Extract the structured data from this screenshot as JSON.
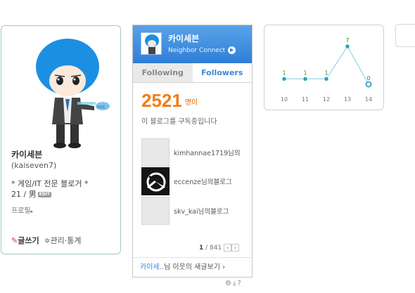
{
  "profile": {
    "nickname": "카이세븐",
    "user_id": "(kaiseven7)",
    "intro_line1": "* 게임/IT 전문 블로거 *",
    "intro_line2": "21 / 男",
    "edit_badge": "EDIT",
    "profile_link": "프로필",
    "write_label": "글쓰기",
    "manage_label": "관리·통계"
  },
  "neighbor": {
    "name": "카이세븐",
    "subtitle": "Neighbor Connect",
    "tabs": [
      {
        "label": "Following",
        "active": false
      },
      {
        "label": "Followers",
        "active": true
      }
    ],
    "count": "2521",
    "count_unit": "명이",
    "subscribe_text": "이 블로그를 구독중입니다",
    "followers": [
      {
        "name": "kimhannae1719님의"
      },
      {
        "name": "eccenze님의블로그"
      },
      {
        "name": "skv_kai님의블로그"
      }
    ],
    "page_current": "1",
    "page_total": "/ 841",
    "footer_highlight": "카이세..",
    "footer_text": "님 이웃의 새글보기",
    "accent_color": "#3a87d8",
    "count_color": "#f07e1a"
  },
  "chart_data": {
    "type": "line",
    "categories": [
      "10",
      "11",
      "12",
      "13",
      "14"
    ],
    "values": [
      1,
      1,
      1,
      7,
      0
    ],
    "data_labels": [
      "1",
      "1",
      "1",
      "7",
      "0"
    ],
    "title": "",
    "xlabel": "",
    "ylabel": "",
    "line_color": "#a9dde9",
    "point_color": "#2aa3b8",
    "label_color": "#2e8b2e"
  }
}
